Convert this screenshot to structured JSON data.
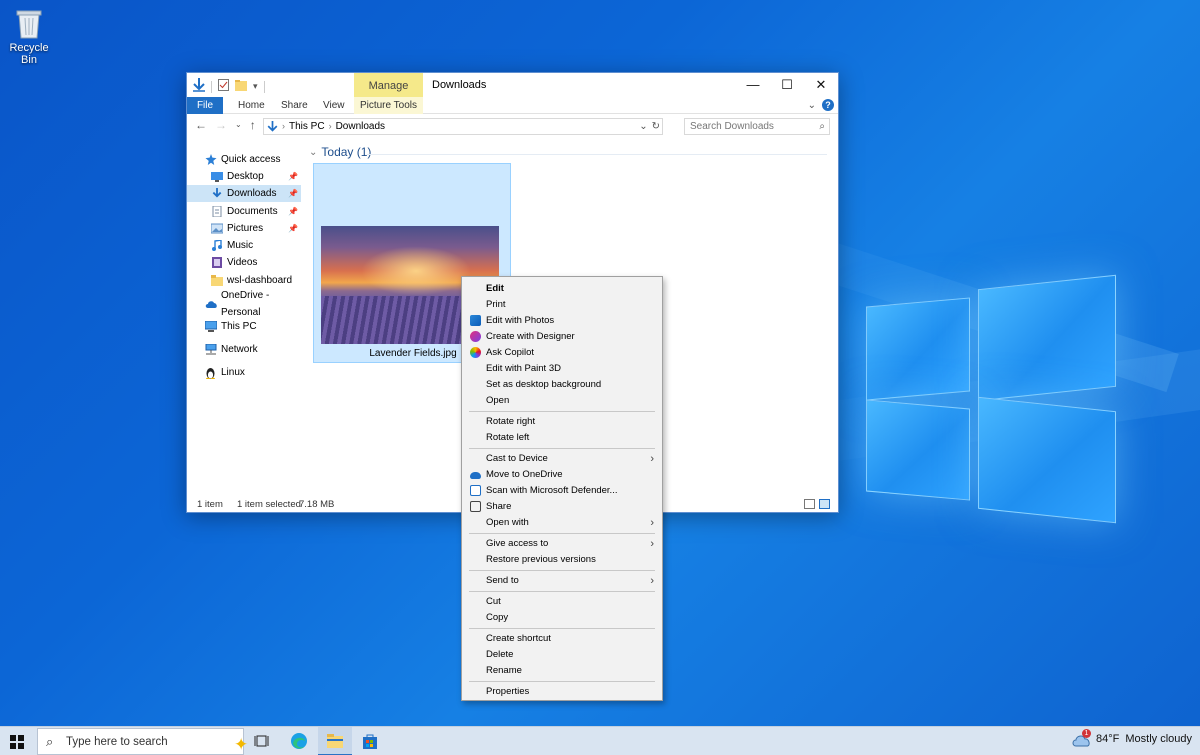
{
  "desktop": {
    "recycle_bin_label": "Recycle Bin"
  },
  "explorer": {
    "title": "Downloads",
    "manage_tab": "Manage",
    "picture_tools_tab": "Picture Tools",
    "ribbon_tabs": [
      "File",
      "Home",
      "Share",
      "View"
    ],
    "address": {
      "segments": [
        "This PC",
        "Downloads"
      ]
    },
    "search_placeholder": "Search Downloads",
    "nav_items": [
      {
        "label": "Quick access",
        "icon": "star-icon"
      },
      {
        "label": "Desktop",
        "icon": "desktop-icon",
        "pinned": true
      },
      {
        "label": "Downloads",
        "icon": "downloads-icon",
        "pinned": true,
        "selected": true
      },
      {
        "label": "Documents",
        "icon": "documents-icon",
        "pinned": true
      },
      {
        "label": "Pictures",
        "icon": "pictures-icon",
        "pinned": true
      },
      {
        "label": "Music",
        "icon": "music-icon"
      },
      {
        "label": "Videos",
        "icon": "videos-icon"
      },
      {
        "label": "wsl-dashboard",
        "icon": "folder-icon"
      },
      {
        "label": "OneDrive - Personal",
        "icon": "onedrive-icon"
      },
      {
        "label": "This PC",
        "icon": "pc-icon"
      },
      {
        "label": "Network",
        "icon": "network-icon"
      },
      {
        "label": "Linux",
        "icon": "linux-icon"
      }
    ],
    "group_header": "Today (1)",
    "file": {
      "name": "Lavender Fields.jpg"
    },
    "status": {
      "count": "1 item",
      "selected": "1 item selected",
      "size": "7.18 MB"
    }
  },
  "context_menu": {
    "items": [
      {
        "label": "Edit",
        "bold": true
      },
      {
        "label": "Print"
      },
      {
        "label": "Edit with Photos",
        "icon": "photos-icon"
      },
      {
        "label": "Create with Designer",
        "icon": "designer-icon"
      },
      {
        "label": "Ask Copilot",
        "icon": "copilot-icon"
      },
      {
        "label": "Edit with Paint 3D"
      },
      {
        "label": "Set as desktop background"
      },
      {
        "label": "Open"
      },
      {
        "sep": true
      },
      {
        "label": "Rotate right"
      },
      {
        "label": "Rotate left"
      },
      {
        "sep": true
      },
      {
        "label": "Cast to Device",
        "submenu": true
      },
      {
        "label": "Move to OneDrive",
        "icon": "onedrive-icon"
      },
      {
        "label": "Scan with Microsoft Defender...",
        "icon": "defender-icon"
      },
      {
        "label": "Share",
        "icon": "share-icon"
      },
      {
        "label": "Open with",
        "submenu": true
      },
      {
        "sep": true
      },
      {
        "label": "Give access to",
        "submenu": true
      },
      {
        "label": "Restore previous versions"
      },
      {
        "sep": true
      },
      {
        "label": "Send to",
        "submenu": true
      },
      {
        "sep": true
      },
      {
        "label": "Cut"
      },
      {
        "label": "Copy"
      },
      {
        "sep": true
      },
      {
        "label": "Create shortcut"
      },
      {
        "label": "Delete"
      },
      {
        "label": "Rename"
      },
      {
        "sep": true
      },
      {
        "label": "Properties"
      }
    ]
  },
  "taskbar": {
    "search_placeholder": "Type here to search",
    "weather_temp": "84°F",
    "weather_text": "Mostly cloudy",
    "weather_badge": "1"
  },
  "colors": {
    "accent": "#1f6fc6",
    "selection": "#cce8ff",
    "manage_tab": "#f5e98a"
  }
}
